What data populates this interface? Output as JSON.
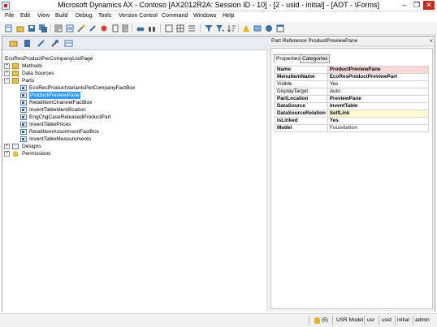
{
  "window": {
    "title": "Microsoft Dynamics AX - Contoso [AX2012R2A: Session ID - 10] - [2 - usid - initial] - [AOT - \\Forms]",
    "minimize": "–",
    "maximize": "❐",
    "close": "✕"
  },
  "menu": [
    "File",
    "Edit",
    "View",
    "Build",
    "Debug",
    "Tools",
    "Version Control",
    "Command",
    "Windows",
    "Help"
  ],
  "tree": {
    "root": "EcoResProductPerCompanyListPage",
    "methods": "Methods",
    "data_sources": "Data Sources",
    "parts": "Parts",
    "part_items": [
      "EcoResProductVariantsPerCompanyFactBox",
      "ProductPreviewPane",
      "RetailItemChannelFactBox",
      "InventTableIdentification",
      "EngChgCaseReleasedProductPart",
      "InventTablePrices",
      "RetailItemAssortmentFactBox",
      "InventTableMeasurements"
    ],
    "designs": "Designs",
    "permissions": "Permissions",
    "expand_glyph": "+",
    "collapse_glyph": "−"
  },
  "properties": {
    "header": "Part Reference ProductPreviewPane",
    "close": "×",
    "tabs": [
      "Properties",
      "Categories"
    ],
    "rows": [
      {
        "name": "Name",
        "value": "ProductPreviewPane"
      },
      {
        "name": "MenuItemName",
        "value": "EcoResProductPreviewPart"
      },
      {
        "name": "Visible",
        "value": "Yes"
      },
      {
        "name": "DisplayTarget",
        "value": "Auto"
      },
      {
        "name": "PartLocation",
        "value": "PreviewPane"
      },
      {
        "name": "DataSource",
        "value": "InventTable"
      },
      {
        "name": "DataSourceRelation",
        "value": "SelfLink"
      },
      {
        "name": "IsLinked",
        "value": "Yes"
      },
      {
        "name": "Model",
        "value": "Foundation"
      }
    ]
  },
  "status": {
    "notifications": "(5)",
    "model": "USR Model",
    "layer": "usr",
    "user": "usid",
    "partition": "initial",
    "company": "admin"
  },
  "colors": {
    "selection": "#3399ff",
    "close_button": "#c42b1c",
    "name_highlight": "#fbd8d8",
    "relation_highlight": "#fffbd0"
  }
}
